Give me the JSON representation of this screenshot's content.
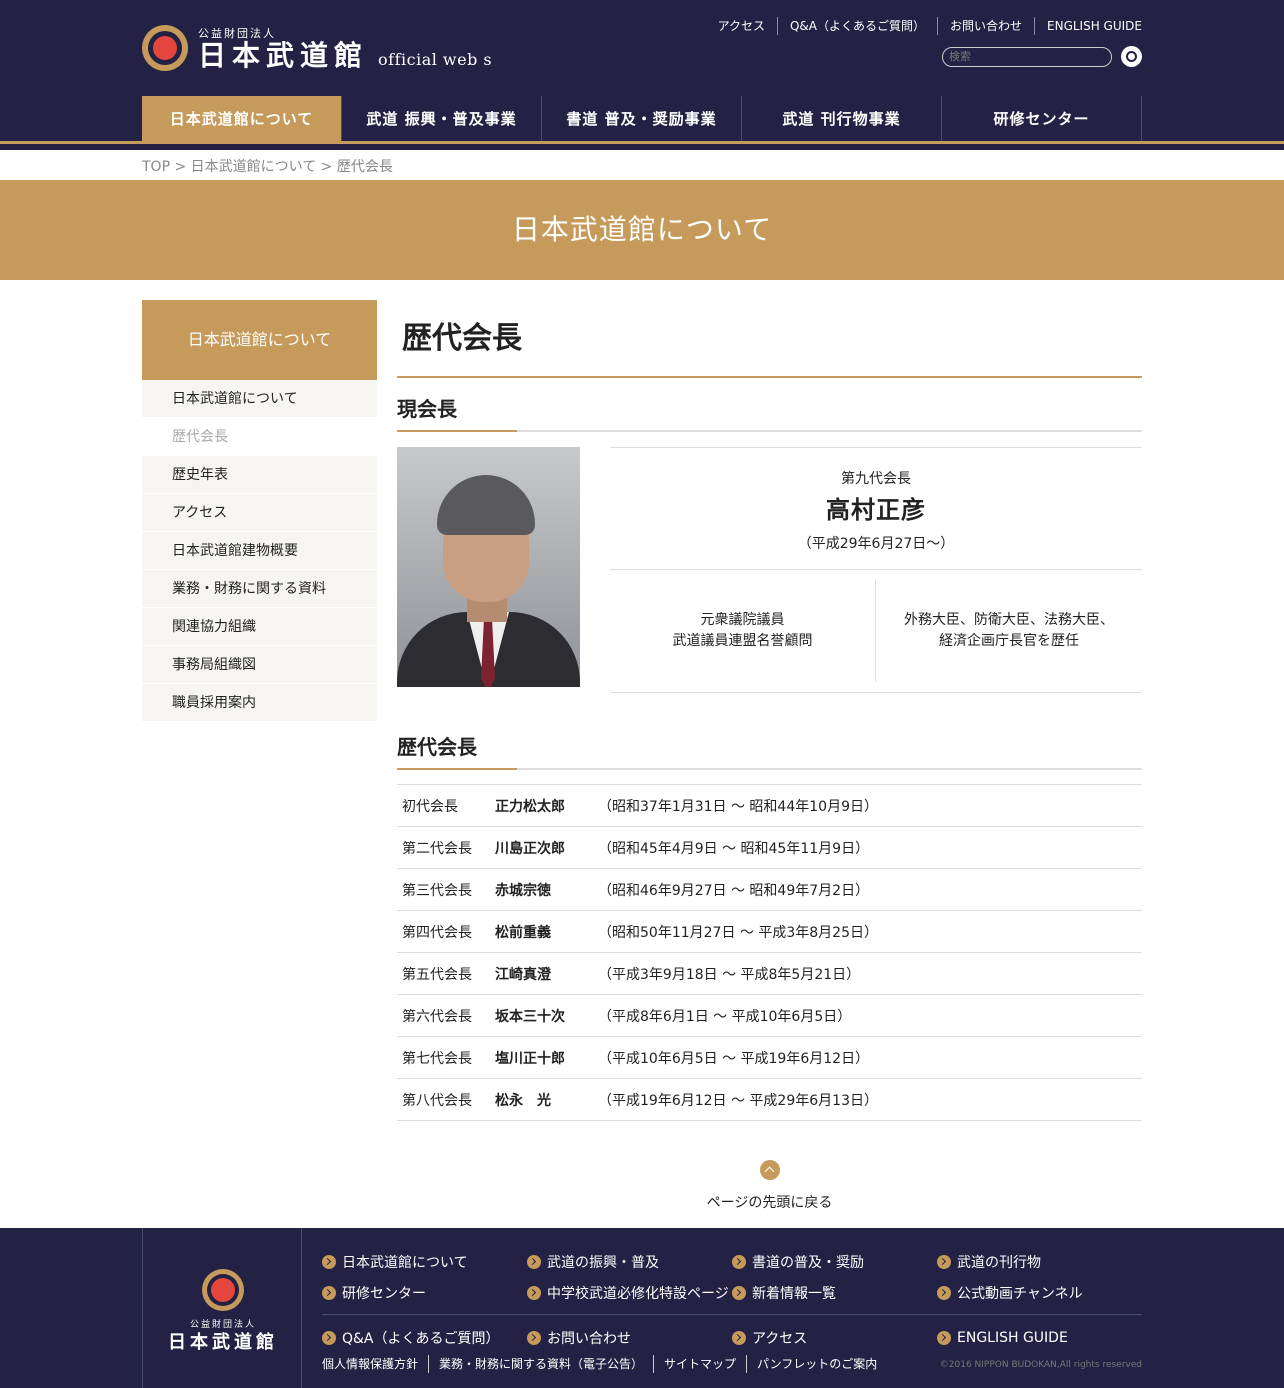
{
  "header": {
    "logo_small": "公益財団法人",
    "logo_big": "日本武道館",
    "logo_sub": "official web s",
    "toplinks": [
      "アクセス",
      "Q&A（よくあるご質問）",
      "お問い合わせ",
      "ENGLISH GUIDE"
    ],
    "search_placeholder": "検索",
    "nav": [
      "日本武道館について",
      "武道 振興・普及事業",
      "書道 普及・奨励事業",
      "武道 刊行物事業",
      "研修センター"
    ]
  },
  "breadcrumb": "TOP > 日本武道館について > 歴代会長",
  "hero_title": "日本武道館について",
  "sidebar": {
    "title": "日本武道館について",
    "items": [
      "日本武道館について",
      "歴代会長",
      "歴史年表",
      "アクセス",
      "日本武道館建物概要",
      "業務・財務に関する資料",
      "関連協力組織",
      "事務局組織図",
      "職員採用案内"
    ]
  },
  "main": {
    "page_title": "歴代会長",
    "current_title": "現会長",
    "current": {
      "generation": "第九代会長",
      "name": "高村正彦",
      "term": "（平成29年6月27日〜）",
      "role_left_1": "元衆議院議員",
      "role_left_2": "武道議員連盟名誉顧問",
      "role_right_1": "外務大臣、防衛大臣、法務大臣、",
      "role_right_2": "経済企画庁長官を歴任"
    },
    "history_title": "歴代会長",
    "history": [
      {
        "gen": "初代会長",
        "name": "正力松太郎",
        "term": "（昭和37年1月31日 〜 昭和44年10月9日）"
      },
      {
        "gen": "第二代会長",
        "name": "川島正次郎",
        "term": "（昭和45年4月9日 〜 昭和45年11月9日）"
      },
      {
        "gen": "第三代会長",
        "name": "赤城宗徳",
        "term": "（昭和46年9月27日 〜 昭和49年7月2日）"
      },
      {
        "gen": "第四代会長",
        "name": "松前重義",
        "term": "（昭和50年11月27日 〜 平成3年8月25日）"
      },
      {
        "gen": "第五代会長",
        "name": "江崎真澄",
        "term": "（平成3年9月18日 〜 平成8年5月21日）"
      },
      {
        "gen": "第六代会長",
        "name": "坂本三十次",
        "term": "（平成8年6月1日 〜 平成10年6月5日）"
      },
      {
        "gen": "第七代会長",
        "name": "塩川正十郎",
        "term": "（平成10年6月5日 〜 平成19年6月12日）"
      },
      {
        "gen": "第八代会長",
        "name": "松永　光",
        "term": "（平成19年6月12日 〜 平成29年6月13日）"
      }
    ],
    "back_to_top": "ページの先頭に戻る"
  },
  "footer": {
    "logo_small": "公益財団法人",
    "logo_big": "日本武道館",
    "links_row1": [
      "日本武道館について",
      "武道の振興・普及",
      "書道の普及・奨励",
      "武道の刊行物",
      "研修センター",
      "中学校武道必修化特設ページ",
      "新着情報一覧",
      "公式動画チャンネル"
    ],
    "links_row2": [
      "Q&A（よくあるご質問）",
      "お問い合わせ",
      "アクセス",
      "ENGLISH GUIDE"
    ],
    "bottom_links": [
      "個人情報保護方針",
      "業務・財務に関する資料（電子公告）",
      "サイトマップ",
      "パンフレットのご案内"
    ],
    "copyright": "©2016 NIPPON BUDOKAN,All rights reserved"
  },
  "colors": {
    "navy": "#232244",
    "gold": "#c59a5a",
    "red": "#e3463c"
  }
}
